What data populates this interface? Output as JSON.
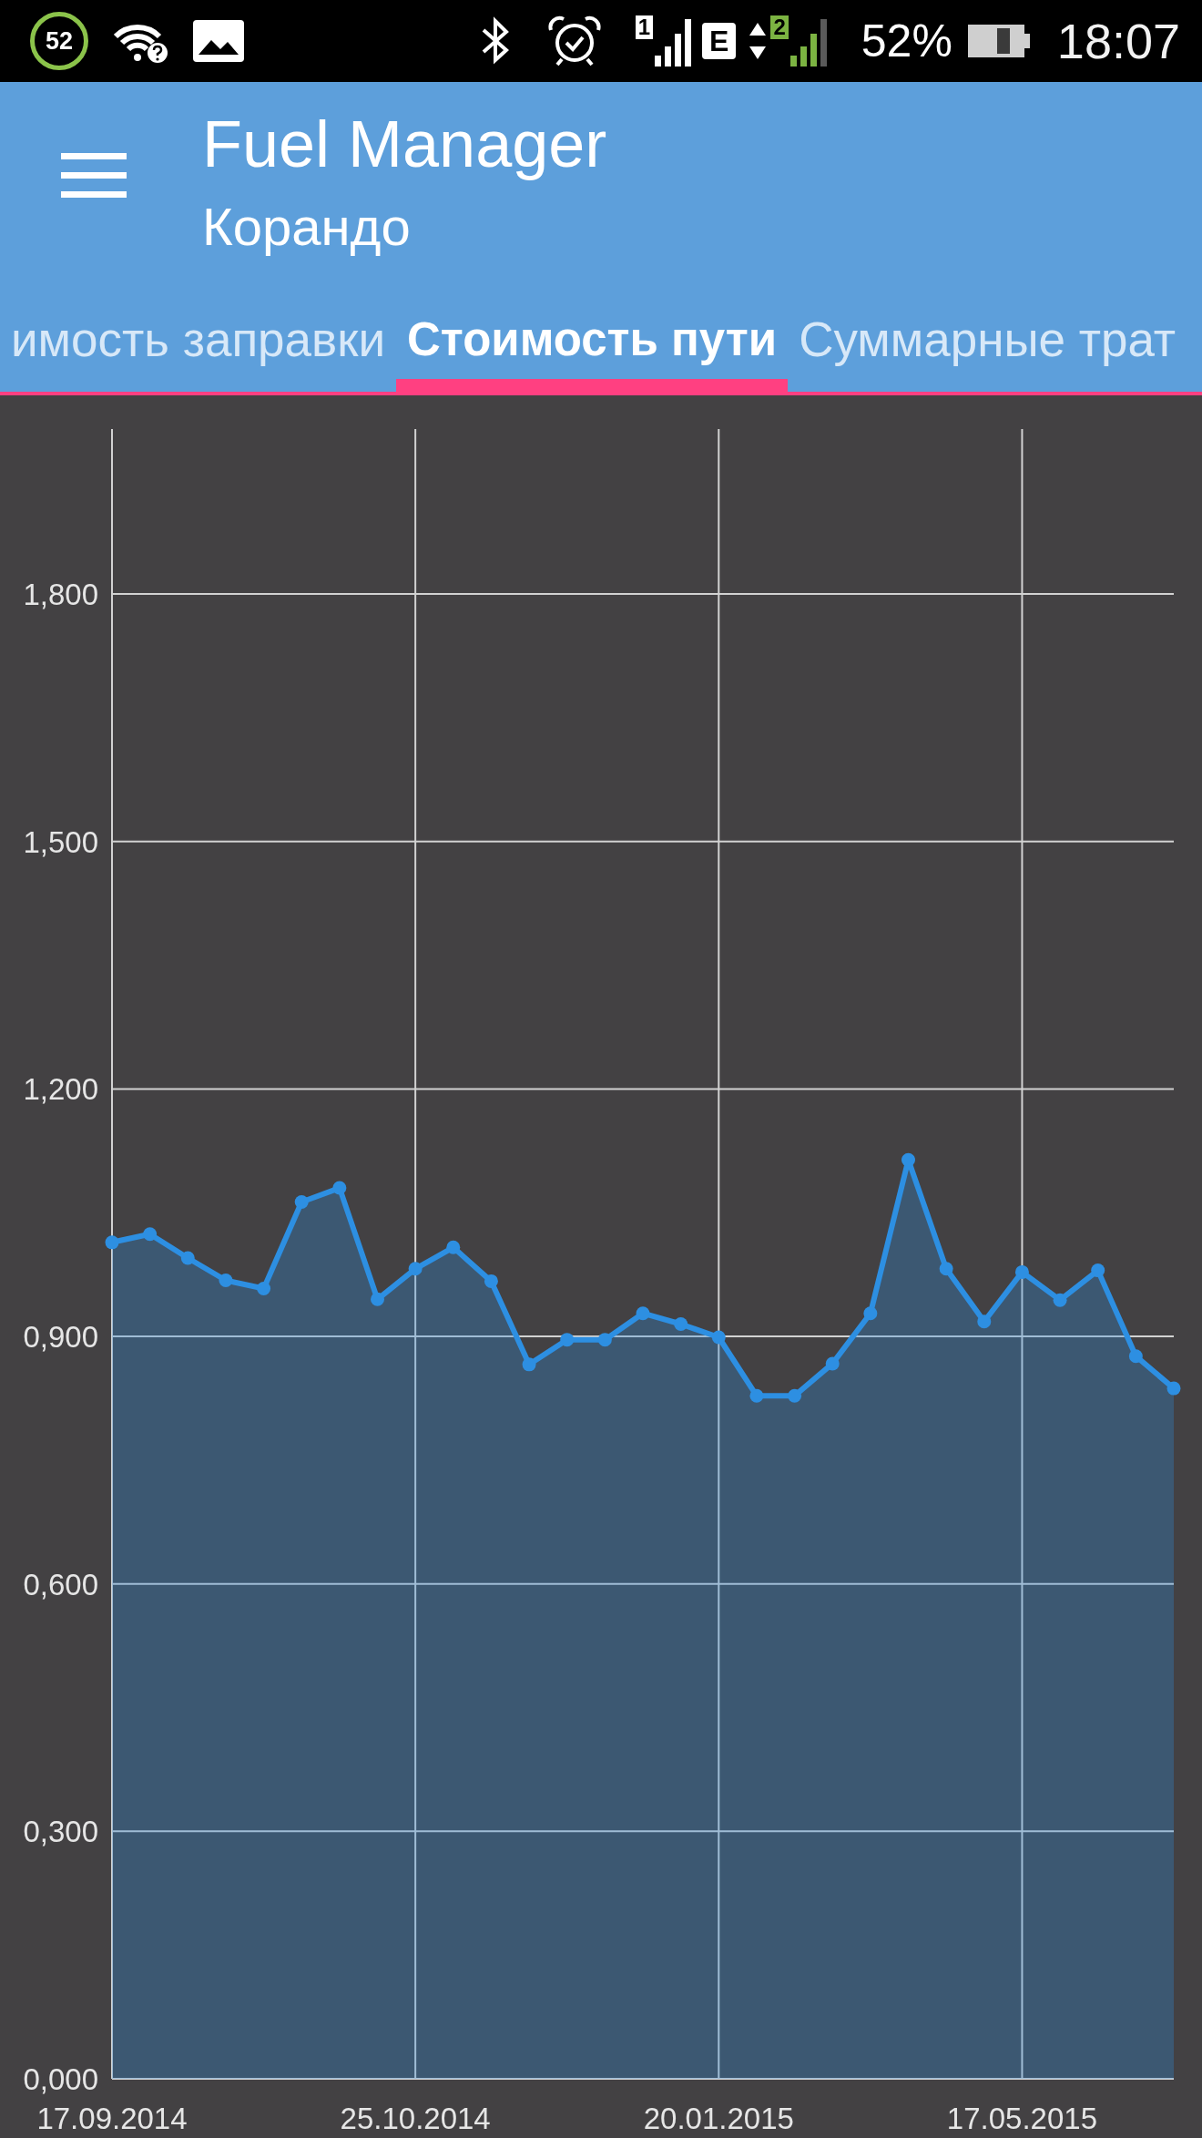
{
  "status_bar": {
    "notification_count": "52",
    "sim1_label": "1",
    "network_type": "E",
    "sim2_label": "2",
    "battery_percent": "52%",
    "time": "18:07"
  },
  "app_bar": {
    "title": "Fuel Manager",
    "subtitle": "Корандо"
  },
  "tabs": [
    {
      "label": "имость заправки",
      "selected": false
    },
    {
      "label": "Стоимость пути",
      "selected": true
    },
    {
      "label": "Суммарные трат",
      "selected": false
    }
  ],
  "chart": {
    "chart_data": {
      "type": "area",
      "grid": true,
      "categories": [
        "17.09.2014",
        null,
        null,
        null,
        null,
        null,
        null,
        null,
        "25.10.2014",
        null,
        null,
        null,
        null,
        null,
        null,
        null,
        "20.01.2015",
        null,
        null,
        null,
        null,
        null,
        null,
        null,
        "17.05.2015",
        null,
        null,
        null,
        null
      ],
      "values": [
        1.014,
        1.024,
        0.995,
        0.968,
        0.958,
        1.063,
        1.08,
        0.945,
        0.982,
        1.008,
        0.967,
        0.866,
        0.896,
        0.896,
        0.928,
        0.915,
        0.899,
        0.828,
        0.828,
        0.867,
        0.928,
        1.114,
        0.982,
        0.918,
        0.978,
        0.944,
        0.98,
        0.876,
        0.837
      ],
      "ylim": [
        0,
        2
      ],
      "yticks": [
        {
          "value": 0,
          "label": "0,000"
        },
        {
          "value": 0.3,
          "label": "0,300"
        },
        {
          "value": 0.6,
          "label": "0,600"
        },
        {
          "value": 0.9,
          "label": "0,900"
        },
        {
          "value": 1.2,
          "label": "1,200"
        },
        {
          "value": 1.5,
          "label": "1,500"
        },
        {
          "value": 1.8,
          "label": "1,800"
        }
      ]
    }
  }
}
